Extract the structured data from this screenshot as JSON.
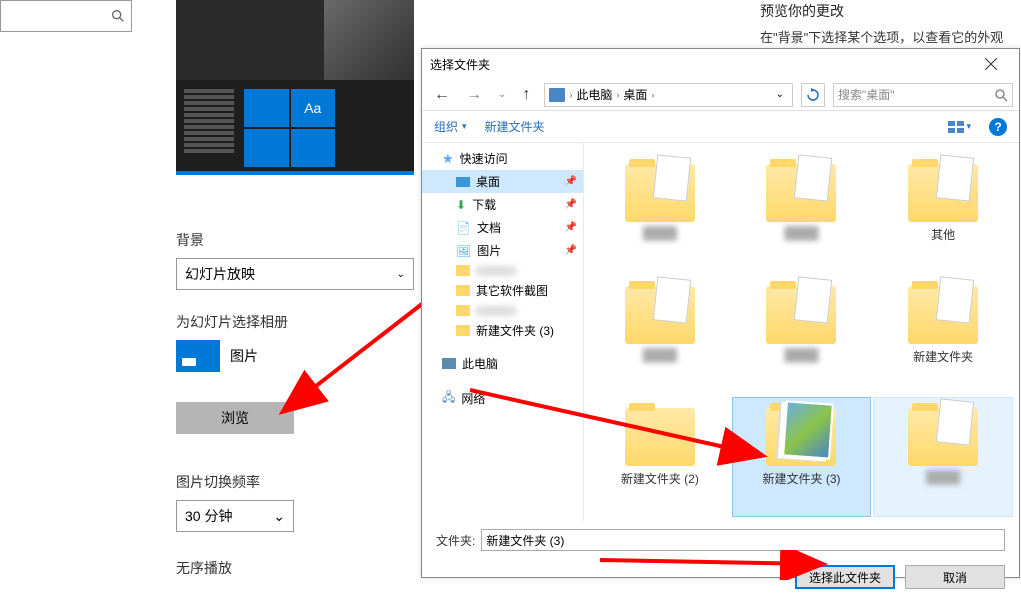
{
  "left_search_placeholder": "",
  "help": {
    "title": "预览你的更改",
    "body": "在\"背景\"下选择某个选项，以查看它的外观预览。要调整颜色、声音等，请"
  },
  "preview": {
    "aa": "Aa"
  },
  "settings": {
    "bg_label": "背景",
    "bg_value": "幻灯片放映",
    "album_label": "为幻灯片选择相册",
    "album_name": "图片",
    "browse": "浏览",
    "freq_label": "图片切换频率",
    "freq_value": "30 分钟",
    "shuffle_label": "无序播放"
  },
  "dialog": {
    "title": "选择文件夹",
    "breadcrumb": {
      "pc": "此电脑",
      "loc": "桌面"
    },
    "search_placeholder": "搜索\"桌面\"",
    "toolbar": {
      "organize": "组织",
      "new_folder": "新建文件夹"
    },
    "tree": {
      "quick_access": "快速访问",
      "desktop": "桌面",
      "downloads": "下载",
      "documents": "文档",
      "pictures": "图片",
      "blank": " ",
      "screenshots": "其它软件截图",
      "blank2": " ",
      "newfolder3": "新建文件夹 (3)",
      "this_pc": "此电脑",
      "network": "网络"
    },
    "items": [
      {
        "label": "",
        "blur": true,
        "kind": "folder-doc"
      },
      {
        "label": "",
        "blur": true,
        "kind": "folder-doc"
      },
      {
        "label": "其他",
        "kind": "folder-doc"
      },
      {
        "label": "",
        "blur": true,
        "kind": "folder-doc"
      },
      {
        "label": "",
        "blur": true,
        "kind": "folder-doc"
      },
      {
        "label": "新建文件夹",
        "kind": "folder-doc"
      },
      {
        "label": "新建文件夹 (2)",
        "kind": "folder"
      },
      {
        "label": "新建文件夹 (3)",
        "kind": "folder-thumbs",
        "selected": true
      },
      {
        "label": "",
        "blur": true,
        "kind": "folder-doc",
        "hover": true
      }
    ],
    "folder_label": "文件夹:",
    "folder_value": "新建文件夹 (3)",
    "ok": "选择此文件夹",
    "cancel": "取消"
  }
}
